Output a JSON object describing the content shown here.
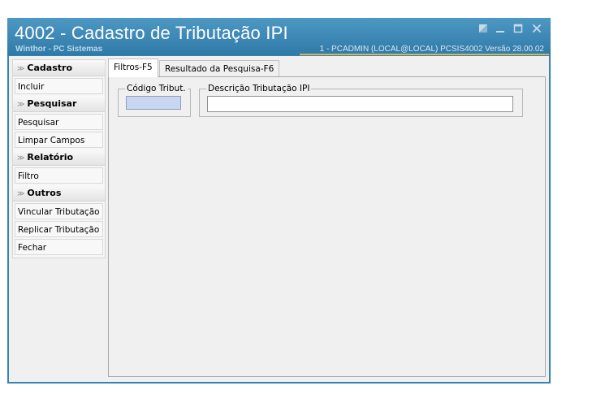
{
  "window": {
    "title": "4002 - Cadastro de Tributação IPI",
    "subtitle": "Winthor - PC Sistemas",
    "status": "1 - PCADMIN (LOCAL@LOCAL)  PCSIS4002  Versão 28.00.02",
    "accent_color": "#3583b1",
    "controls": [
      "restore-icon",
      "minimize-icon",
      "maximize-icon",
      "close-icon"
    ]
  },
  "sidebar": {
    "groups": [
      {
        "label": "Cadastro",
        "items": [
          "Incluir"
        ]
      },
      {
        "label": "Pesquisar",
        "items": [
          "Pesquisar",
          "Limpar Campos"
        ]
      },
      {
        "label": "Relatório",
        "items": [
          "Filtro"
        ]
      },
      {
        "label": "Outros",
        "items": [
          "Vincular Tributação",
          "Replicar Tributação",
          "Fechar"
        ]
      }
    ]
  },
  "tabs": [
    {
      "label": "Filtros-F5",
      "active": true
    },
    {
      "label": "Resultado da Pesquisa-F6",
      "active": false
    }
  ],
  "filters": {
    "codigo_label": "Código Tribut.",
    "codigo_value": "",
    "descricao_label": "Descrição Tributação IPI",
    "descricao_value": ""
  }
}
